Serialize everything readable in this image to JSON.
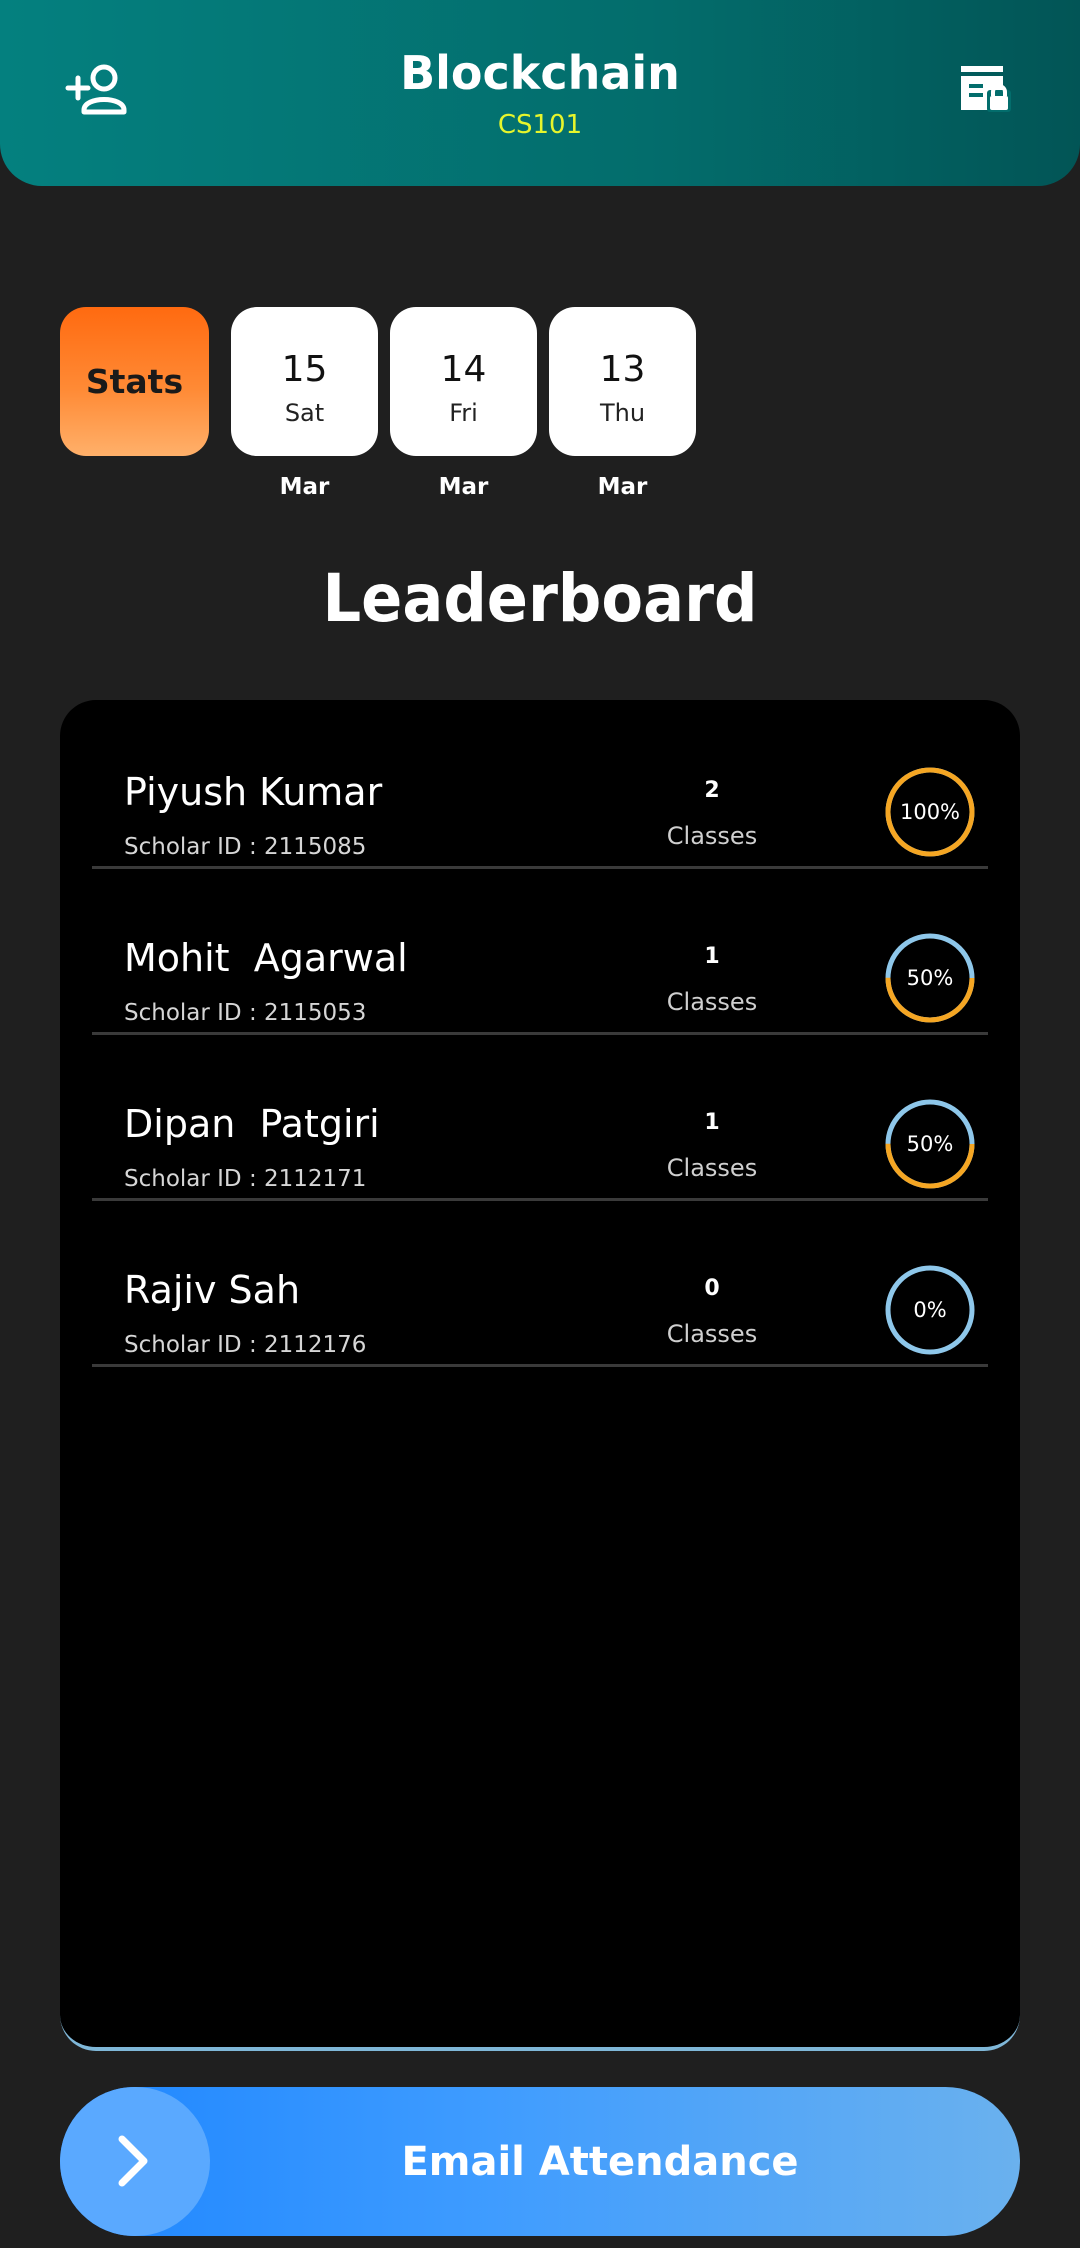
{
  "header": {
    "title": "Blockchain",
    "course_code": "CS101",
    "add_icon": "add-person-icon",
    "lock_icon": "locked-list-icon"
  },
  "stats": {
    "label": "Stats",
    "gradient": [
      "#ff6a10",
      "#ffb06a"
    ]
  },
  "dates": [
    {
      "day": "15",
      "weekday": "Sat",
      "month": "Mar"
    },
    {
      "day": "14",
      "weekday": "Fri",
      "month": "Mar"
    },
    {
      "day": "13",
      "weekday": "Thu",
      "month": "Mar"
    }
  ],
  "leaderboard": {
    "title": "Leaderboard",
    "rows": [
      {
        "name": "Piyush Kumar",
        "scholar": "Scholar ID : 2115085",
        "count": "2",
        "classes_label": "Classes",
        "percent_label": "100%",
        "percent": 100
      },
      {
        "name": "Mohit  Agarwal",
        "scholar": "Scholar ID : 2115053",
        "count": "1",
        "classes_label": "Classes",
        "percent_label": "50%",
        "percent": 50
      },
      {
        "name": "Dipan  Patgiri",
        "scholar": "Scholar ID : 2112171",
        "count": "1",
        "classes_label": "Classes",
        "percent_label": "50%",
        "percent": 50
      },
      {
        "name": "Rajiv Sah",
        "scholar": "Scholar ID : 2112176",
        "count": "0",
        "classes_label": "Classes",
        "percent_label": "0%",
        "percent": 0
      }
    ],
    "ring_colors": {
      "filled": "#f5a623",
      "empty": "#8ec7ea"
    }
  },
  "footer": {
    "email_label": "Email Attendance",
    "chevron_icon": "chevron-right-icon"
  }
}
